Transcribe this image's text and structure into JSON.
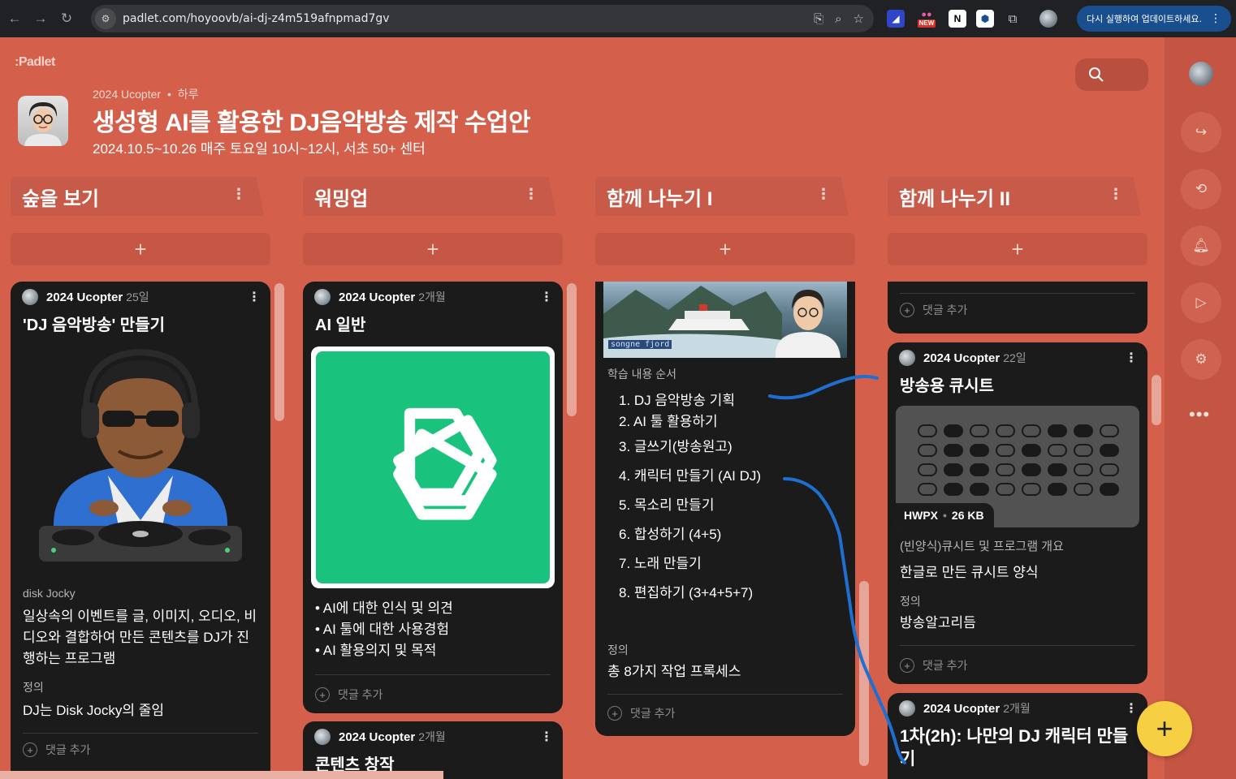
{
  "browser": {
    "url": "padlet.com/hoyoovb/ai-dj-z4m519afnpmad7gv",
    "update_label": "다시 실행하여 업데이트하세요.",
    "new_badge": "NEW"
  },
  "header": {
    "logo": ":Padlet",
    "author": "2024 Ucopter",
    "separator": "•",
    "age": "하루",
    "title": "생성형 AI를 활용한 DJ음악방송 제작 수업안",
    "subtitle": "2024.10.5~10.26 매주 토요일 10시~12시, 서초 50+ 센터"
  },
  "sections": [
    {
      "label": "숲을 보기",
      "menu": "⋮",
      "add": "+"
    },
    {
      "label": "워밍업",
      "menu": "⋮",
      "add": "+"
    },
    {
      "label": "함께 나누기 I",
      "menu": "⋮",
      "add": "+"
    },
    {
      "label": "함께 나누기 II",
      "menu": "⋮",
      "add": "+"
    }
  ],
  "col1": {
    "card1": {
      "author": "2024 Ucopter",
      "ago": "25일",
      "title": "'DJ 음악방송' 만들기",
      "caption": "disk Jocky",
      "body": "일상속의 이벤트를 글, 이미지, 오디오, 비디오와 결합하여 만든 콘텐츠를 DJ가 진행하는 프로그램",
      "def_label": "정의",
      "def_text": "DJ는 Disk Jocky의 줄임",
      "comment": "댓글 추가"
    }
  },
  "col2": {
    "card1": {
      "author": "2024 Ucopter",
      "ago": "2개월",
      "title": "AI 일반",
      "bullets": [
        "• AI에 대한 인식 및 의견",
        "• AI 툴에 대한 사용경험",
        "• AI 활용의지 및 목적"
      ],
      "comment": "댓글 추가"
    },
    "card2": {
      "author": "2024 Ucopter",
      "ago": "2개월",
      "title": "콘텐츠 창작"
    }
  },
  "col3": {
    "card1": {
      "image_text": "songne fjord",
      "steps_label": "학습 내용 순서",
      "steps": [
        "1. DJ 음악방송 기획",
        "2. AI 툴 활용하기",
        "3. 글쓰기(방송원고)",
        "4. 캐릭터 만들기 (AI DJ)",
        "5. 목소리 만들기",
        "6. 합성하기 (4+5)",
        "7. 노래 만들기",
        "8. 편집하기 (3+4+5+7)"
      ],
      "def_label": "정의",
      "def_text": "총 8가지 작업 프록세스",
      "comment": "댓글 추가"
    }
  },
  "col4": {
    "card0": {
      "comment": "댓글 추가"
    },
    "card1": {
      "author": "2024 Ucopter",
      "ago": "22일",
      "title": "방송용 큐시트",
      "file_type": "HWPX",
      "file_sep": "•",
      "file_size": "26 KB",
      "file_desc": "(빈양식)큐시트 및 프로그램 개요",
      "body": "한글로 만든 큐시트 양식",
      "def_label": "정의",
      "def_text": "방송알고리듬",
      "comment": "댓글 추가"
    },
    "card2": {
      "author": "2024 Ucopter",
      "ago": "2개월",
      "title": "1차(2h): 나만의 DJ 캐릭터 만들기"
    }
  },
  "fab": {
    "label": "+"
  },
  "rail": {
    "more": "•••"
  },
  "colors": {
    "background": "#d4604c",
    "card": "#1b1b1b",
    "fab": "#f7cf43",
    "annotation": "#1f6fd1",
    "chatgpt": "#19c37d"
  }
}
